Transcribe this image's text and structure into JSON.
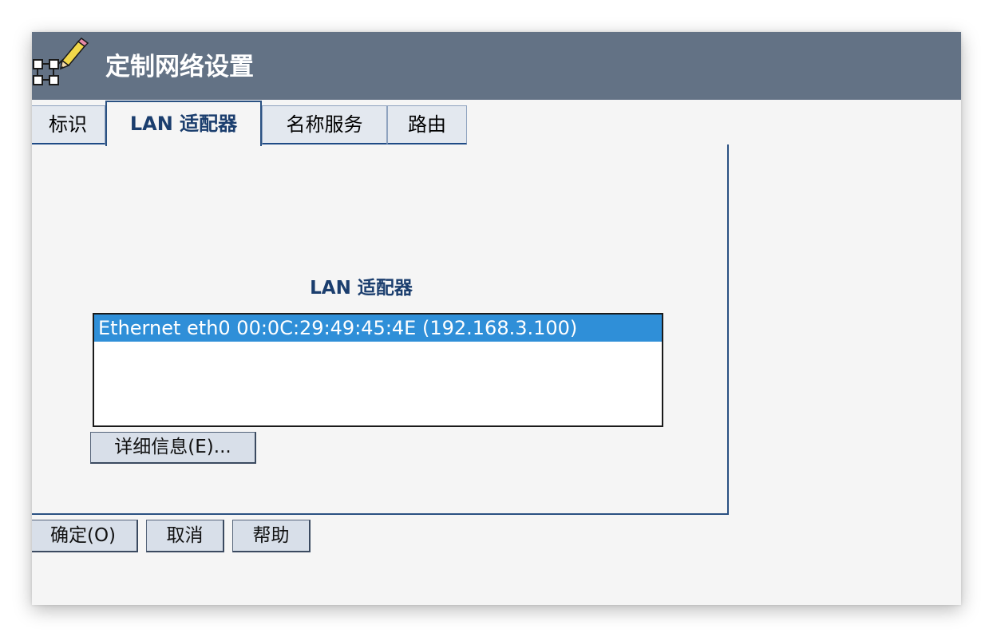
{
  "window": {
    "title": "定制网络设置",
    "icon": "network-pencil-icon"
  },
  "tabs": [
    {
      "label": "标识",
      "active": false
    },
    {
      "label": "LAN 适配器",
      "active": true
    },
    {
      "label": "名称服务",
      "active": false
    },
    {
      "label": "路由",
      "active": false
    }
  ],
  "lan": {
    "heading": "LAN 适配器",
    "adapters": [
      {
        "label": "Ethernet eth0 00:0C:29:49:45:4E (192.168.3.100)",
        "selected": true
      }
    ],
    "details_button": "详细信息(E)..."
  },
  "footer": {
    "ok_label": "确定(O)",
    "cancel_label": "取消",
    "help_label": "帮助"
  },
  "colors": {
    "titlebar": "#637285",
    "selection": "#2f8fd8",
    "accent": "#1b3e6e",
    "background": "#f5f5f5"
  }
}
